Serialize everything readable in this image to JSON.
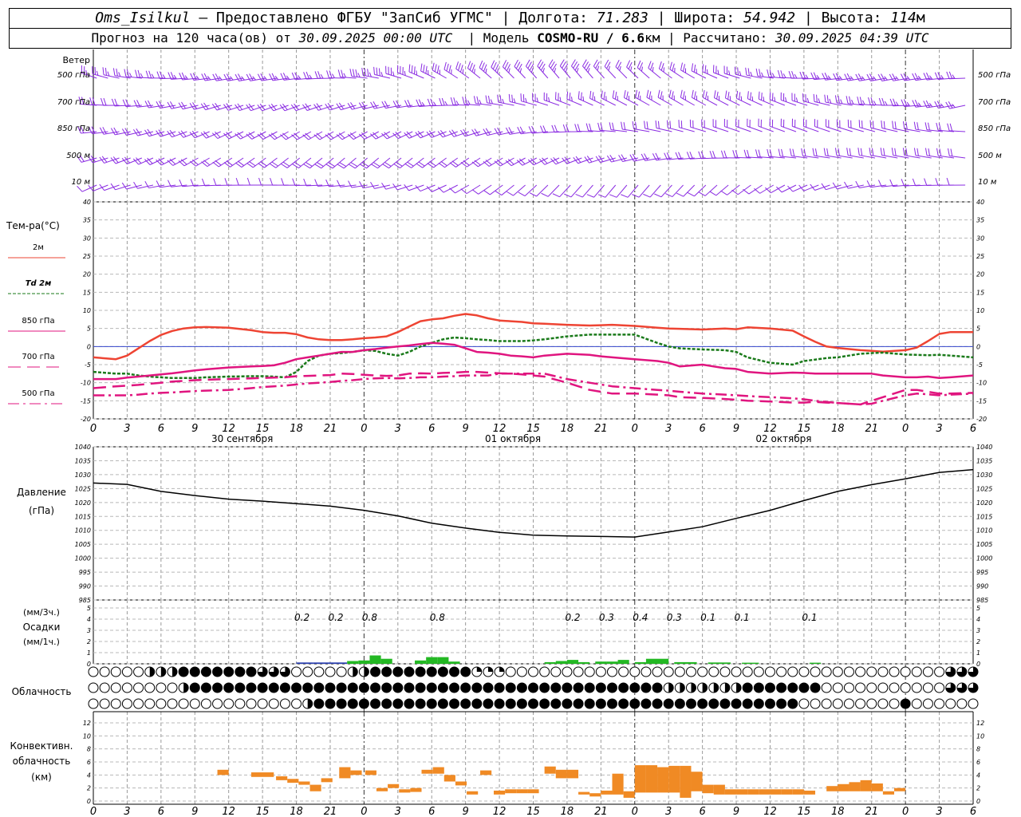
{
  "header": {
    "station": "Oms_Isilkul",
    "provider": "– Предоставлено ФГБУ \"ЗапСиб УГМС\"",
    "lon_label": "Долгота:",
    "lon": "71.283",
    "lat_label": "Широта:",
    "lat": "54.942",
    "alt_label": "Высота:",
    "alt": "114",
    "alt_unit": "м",
    "forecast_prefix": "Прогноз на 120 часа(ов) от",
    "forecast_start": "30.09.2025 00:00 UTC",
    "model_label": "Модель",
    "model": "COSMO-RU / 6.6",
    "model_unit": "км",
    "calc_label": "Рассчитано:",
    "calc_time": "30.09.2025 04:39 UTC"
  },
  "x_ticks": [
    "0",
    "3",
    "6",
    "9",
    "12",
    "15",
    "18",
    "21",
    "0",
    "3",
    "6",
    "9",
    "12",
    "15",
    "18",
    "21",
    "0",
    "3",
    "6",
    "9",
    "12",
    "15",
    "18",
    "21",
    "0",
    "3",
    "6"
  ],
  "date_labels": [
    "30 сентября",
    "01 октября",
    "02 октября"
  ],
  "wind_panel": {
    "title": "Ветер",
    "levels": [
      "500 гПа",
      "700 гПа",
      "850 гПа",
      "500 м",
      "10  м"
    ],
    "color": "#8a2be2"
  },
  "temp_panel": {
    "title": "Тем-ра(°C)",
    "legend": [
      {
        "label": "2м",
        "color": "#ee4433",
        "dash": "solid"
      },
      {
        "label": "Td  2м",
        "color": "#1a7a1a",
        "dash": "dotted"
      },
      {
        "label": "850 гПа",
        "color": "#e0157f",
        "dash": "solid"
      },
      {
        "label": "700 гПа",
        "color": "#e0157f",
        "dash": "dashed"
      },
      {
        "label": "500 гПа",
        "color": "#e0157f",
        "dash": "dashdot"
      }
    ],
    "y_ticks": [
      "40",
      "35",
      "30",
      "25",
      "20",
      "15",
      "10",
      "5",
      "0",
      "-5",
      "-10",
      "-15",
      "-20"
    ]
  },
  "pressure_panel": {
    "title": "Давление",
    "unit": "(гПа)",
    "y_ticks": [
      "1040",
      "1035",
      "1030",
      "1025",
      "1020",
      "1015",
      "1010",
      "1005",
      "1000",
      "995",
      "990",
      "985"
    ]
  },
  "precip_panel": {
    "unit_top": "(мм/3ч.)",
    "title": "Осадки",
    "unit_bottom": "(мм/1ч.)",
    "y_ticks": [
      "5",
      "4",
      "3",
      "2",
      "1",
      "0"
    ],
    "labels": [
      {
        "h": 18,
        "text": "0.2"
      },
      {
        "h": 21,
        "text": "0.2"
      },
      {
        "h": 24,
        "text": "0.8"
      },
      {
        "h": 30,
        "text": "0.8"
      },
      {
        "h": 42,
        "text": "0.2"
      },
      {
        "h": 45,
        "text": "0.3"
      },
      {
        "h": 48,
        "text": "0.4"
      },
      {
        "h": 51,
        "text": "0.3"
      },
      {
        "h": 54,
        "text": "0.1"
      },
      {
        "h": 57,
        "text": "0.1"
      },
      {
        "h": 63,
        "text": "0.1"
      }
    ]
  },
  "cloud_panel": {
    "title": "Облачность"
  },
  "conv_panel": {
    "title_line1": "Конвективн.",
    "title_line2": "облачность",
    "unit": "(км)",
    "y_ticks": [
      "12",
      "10",
      "8",
      "6",
      "4",
      "2",
      "0"
    ],
    "color": "#f08a24"
  },
  "chart_data": [
    {
      "type": "line",
      "title": "Тем-ра(°C)",
      "ylim": [
        -20,
        40
      ],
      "x_hours": [
        0,
        2,
        3,
        4,
        5,
        6,
        7,
        8,
        9,
        10,
        12,
        14,
        15,
        16,
        17,
        18,
        19,
        20,
        21,
        22,
        23,
        24,
        25,
        26,
        27,
        28,
        29,
        30,
        31,
        32,
        33,
        34,
        35,
        36,
        37,
        38,
        39,
        40,
        42,
        44,
        45,
        46,
        48,
        50,
        51,
        52,
        54,
        56,
        57,
        58,
        60,
        62,
        63,
        64,
        65,
        66,
        68,
        69,
        70,
        72,
        73,
        74,
        75,
        76,
        78
      ],
      "series": [
        {
          "name": "2м",
          "values": [
            -3,
            -3.5,
            -2.5,
            -0.5,
            1.5,
            3.2,
            4.3,
            5,
            5.3,
            5.4,
            5.2,
            4.5,
            4,
            3.8,
            3.8,
            3.4,
            2.5,
            2,
            1.8,
            1.8,
            2,
            2.3,
            2.5,
            2.8,
            4,
            5.5,
            7,
            7.5,
            7.8,
            8.5,
            9,
            8.6,
            7.8,
            7.2,
            7,
            6.8,
            6.4,
            6.3,
            6,
            5.8,
            5.9,
            6,
            5.7,
            5.2,
            5,
            4.9,
            4.7,
            5,
            4.8,
            5.3,
            5,
            4.4,
            2.8,
            1.3,
            0,
            -0.4,
            -1,
            -1.2,
            -1.4,
            -1,
            -0.3,
            1.5,
            3.5,
            4,
            4
          ]
        },
        {
          "name": "Td  2м",
          "values": [
            -7,
            -7.5,
            -7.5,
            -8,
            -8.3,
            -8.5,
            -8.7,
            -8.7,
            -8.7,
            -8.5,
            -8.3,
            -8.2,
            -8.2,
            -8.3,
            -8.5,
            -7,
            -4,
            -2.5,
            -2,
            -1.8,
            -1.5,
            -1,
            -1.2,
            -2,
            -2.5,
            -1.5,
            0,
            1,
            2,
            2.5,
            2.3,
            2,
            1.8,
            1.5,
            1.5,
            1.5,
            1.7,
            2,
            2.8,
            3.3,
            3.3,
            3.3,
            3.3,
            1,
            0,
            -0.5,
            -0.8,
            -1,
            -1.5,
            -3,
            -4.5,
            -5,
            -4,
            -3.6,
            -3.2,
            -3,
            -2,
            -1.8,
            -1.7,
            -2.2,
            -2.3,
            -2.4,
            -2.3,
            -2.5,
            -3
          ]
        },
        {
          "name": "850 гПа",
          "values": [
            -9,
            -9,
            -8.6,
            -8.3,
            -8,
            -7.7,
            -7.4,
            -7,
            -6.6,
            -6.3,
            -5.8,
            -5.5,
            -5.4,
            -5.2,
            -4.5,
            -3.5,
            -3,
            -2.5,
            -2,
            -1.5,
            -1.5,
            -1,
            -0.7,
            -0.3,
            0,
            0.3,
            0.7,
            1,
            0.8,
            0.5,
            -0.5,
            -1.5,
            -1.7,
            -2,
            -2.5,
            -2.7,
            -3,
            -2.5,
            -2,
            -2.3,
            -2.7,
            -3,
            -3.5,
            -4,
            -4.5,
            -5.5,
            -5,
            -6,
            -6.2,
            -7,
            -7.5,
            -7.2,
            -7.3,
            -7.5,
            -7.5,
            -7.5,
            -7.5,
            -7.5,
            -8,
            -8.5,
            -8.5,
            -8.3,
            -8.7,
            -8.5,
            -8
          ]
        },
        {
          "name": "700 гПа",
          "values": [
            -11.5,
            -11,
            -10.8,
            -10.6,
            -10.3,
            -10,
            -9.7,
            -9.5,
            -9.3,
            -9.2,
            -9,
            -8.8,
            -8.7,
            -8.6,
            -8.5,
            -8.2,
            -8.1,
            -8,
            -7.9,
            -7.5,
            -7.6,
            -7.8,
            -8,
            -8.1,
            -8,
            -7.5,
            -7.4,
            -7.5,
            -7.3,
            -7.2,
            -7,
            -7,
            -7.2,
            -7.4,
            -7.5,
            -7.7,
            -8,
            -8.3,
            -10,
            -12,
            -12.5,
            -13,
            -13,
            -13.3,
            -13.5,
            -14,
            -14.2,
            -14.5,
            -14.7,
            -15,
            -15.2,
            -15.5,
            -15.5,
            -15.3,
            -15.5,
            -15.6,
            -16,
            -15,
            -14,
            -12,
            -12,
            -12.5,
            -13,
            -13,
            -12.8
          ]
        },
        {
          "name": "500 гПа",
          "values": [
            -13.5,
            -13.5,
            -13.5,
            -13.3,
            -13,
            -12.8,
            -12.7,
            -12.5,
            -12.3,
            -12.2,
            -12,
            -11.5,
            -11.2,
            -11,
            -10.8,
            -10.5,
            -10.2,
            -10,
            -9.8,
            -9.5,
            -9.3,
            -9,
            -8.8,
            -8.7,
            -8.8,
            -8.7,
            -8.5,
            -8.5,
            -8.3,
            -8.2,
            -8,
            -8,
            -8,
            -7.5,
            -7.5,
            -7.5,
            -7.5,
            -7.5,
            -9,
            -10,
            -10.5,
            -11,
            -11.5,
            -12,
            -12.2,
            -12.5,
            -13,
            -13.3,
            -13.5,
            -13.7,
            -14,
            -14.3,
            -14.6,
            -15,
            -15.3,
            -15.6,
            -16,
            -15.8,
            -15,
            -13.5,
            -13,
            -13.2,
            -13.5,
            -13.3,
            -13
          ]
        }
      ]
    },
    {
      "type": "line",
      "title": "Давление",
      "ylabel": "(гПа)",
      "ylim": [
        985,
        1040
      ],
      "x_hours": [
        0,
        3,
        6,
        9,
        12,
        15,
        18,
        21,
        24,
        27,
        30,
        33,
        36,
        39,
        42,
        45,
        48,
        51,
        54,
        57,
        60,
        63,
        66,
        69,
        72,
        75,
        78
      ],
      "series": [
        {
          "name": "Давление",
          "values": [
            1027,
            1026.5,
            1024,
            1022.5,
            1021.2,
            1020.5,
            1019.6,
            1018.7,
            1017.2,
            1015.2,
            1012.6,
            1010.8,
            1009.3,
            1008.3,
            1008,
            1007.8,
            1007.6,
            1009.4,
            1011.3,
            1014.3,
            1017.2,
            1020.7,
            1024,
            1026.4,
            1028.5,
            1030.8,
            1031.8
          ]
        }
      ]
    },
    {
      "type": "bar",
      "title": "Осадки",
      "ylabel": "(мм/1ч.)",
      "ylim": [
        0,
        5
      ],
      "bars": [
        {
          "h": 18.5,
          "w": 1.5,
          "v": 0.12,
          "c": "#2b3fb0"
        },
        {
          "h": 20,
          "w": 1.5,
          "v": 0.12,
          "c": "#2b3fb0"
        },
        {
          "h": 21.5,
          "w": 1.5,
          "v": 0.12,
          "c": "#2b3fb0"
        },
        {
          "h": 23,
          "w": 1,
          "v": 0.25,
          "c": "#23b823"
        },
        {
          "h": 24,
          "w": 1,
          "v": 0.3,
          "c": "#23b823"
        },
        {
          "h": 25,
          "w": 1,
          "v": 0.75,
          "c": "#23b823"
        },
        {
          "h": 26,
          "w": 1,
          "v": 0.45,
          "c": "#23b823"
        },
        {
          "h": 29,
          "w": 1,
          "v": 0.3,
          "c": "#23b823"
        },
        {
          "h": 30,
          "w": 1,
          "v": 0.6,
          "c": "#23b823"
        },
        {
          "h": 31,
          "w": 1,
          "v": 0.6,
          "c": "#23b823"
        },
        {
          "h": 32,
          "w": 1,
          "v": 0.2,
          "c": "#23b823"
        },
        {
          "h": 40.5,
          "w": 1,
          "v": 0.15,
          "c": "#23b823"
        },
        {
          "h": 41.5,
          "w": 1,
          "v": 0.25,
          "c": "#23b823"
        },
        {
          "h": 42.5,
          "w": 1,
          "v": 0.35,
          "c": "#23b823"
        },
        {
          "h": 43.5,
          "w": 1,
          "v": 0.15,
          "c": "#23b823"
        },
        {
          "h": 45,
          "w": 1,
          "v": 0.2,
          "c": "#23b823"
        },
        {
          "h": 46,
          "w": 1,
          "v": 0.2,
          "c": "#23b823"
        },
        {
          "h": 47,
          "w": 1,
          "v": 0.35,
          "c": "#23b823"
        },
        {
          "h": 48.5,
          "w": 1,
          "v": 0.15,
          "c": "#23b823"
        },
        {
          "h": 49.5,
          "w": 2,
          "v": 0.45,
          "c": "#23b823"
        },
        {
          "h": 52,
          "w": 2,
          "v": 0.15,
          "c": "#23b823"
        },
        {
          "h": 55,
          "w": 2,
          "v": 0.12,
          "c": "#23b823"
        },
        {
          "h": 58,
          "w": 1.5,
          "v": 0.1,
          "c": "#23b823"
        },
        {
          "h": 64,
          "w": 1,
          "v": 0.1,
          "c": "#23b823"
        }
      ]
    },
    {
      "type": "bar",
      "title": "Конвективн. облачность",
      "ylabel": "(км)",
      "ylim": [
        0,
        13
      ],
      "bars": [
        {
          "h": 11.5,
          "w": 1,
          "b": 4.0,
          "t": 4.8
        },
        {
          "h": 14.5,
          "w": 2,
          "b": 3.7,
          "t": 4.4
        },
        {
          "h": 16.7,
          "w": 1,
          "b": 3.2,
          "t": 3.8
        },
        {
          "h": 17.7,
          "w": 1,
          "b": 2.8,
          "t": 3.4
        },
        {
          "h": 18.7,
          "w": 1,
          "b": 2.5,
          "t": 3.0
        },
        {
          "h": 19.7,
          "w": 1,
          "b": 1.5,
          "t": 2.5
        },
        {
          "h": 20.7,
          "w": 1,
          "b": 2.9,
          "t": 3.5
        },
        {
          "h": 22.3,
          "w": 1,
          "b": 3.5,
          "t": 5.2
        },
        {
          "h": 23.3,
          "w": 1,
          "b": 4.0,
          "t": 4.7
        },
        {
          "h": 24.6,
          "w": 1,
          "b": 4.0,
          "t": 4.7
        },
        {
          "h": 25.6,
          "w": 1,
          "b": 1.5,
          "t": 2.0
        },
        {
          "h": 26.6,
          "w": 1,
          "b": 2.0,
          "t": 2.6
        },
        {
          "h": 27.6,
          "w": 1,
          "b": 1.3,
          "t": 1.8
        },
        {
          "h": 28.6,
          "w": 1,
          "b": 1.4,
          "t": 2.0
        },
        {
          "h": 29.6,
          "w": 1,
          "b": 4.2,
          "t": 4.8
        },
        {
          "h": 30.6,
          "w": 1,
          "b": 4.2,
          "t": 5.2
        },
        {
          "h": 31.6,
          "w": 1,
          "b": 3.0,
          "t": 4.0
        },
        {
          "h": 32.6,
          "w": 1,
          "b": 2.4,
          "t": 3.0
        },
        {
          "h": 33.6,
          "w": 1,
          "b": 1.0,
          "t": 1.5
        },
        {
          "h": 34.8,
          "w": 1,
          "b": 4.0,
          "t": 4.7
        },
        {
          "h": 36.0,
          "w": 1,
          "b": 1.0,
          "t": 1.6
        },
        {
          "h": 37.0,
          "w": 1,
          "b": 1.2,
          "t": 1.8
        },
        {
          "h": 38.0,
          "w": 1,
          "b": 1.2,
          "t": 1.8
        },
        {
          "h": 39.0,
          "w": 1,
          "b": 1.2,
          "t": 1.8
        },
        {
          "h": 40.5,
          "w": 1,
          "b": 4.2,
          "t": 5.3
        },
        {
          "h": 41.5,
          "w": 1,
          "b": 3.5,
          "t": 4.8
        },
        {
          "h": 42.5,
          "w": 1,
          "b": 3.5,
          "t": 4.8
        },
        {
          "h": 43.5,
          "w": 1,
          "b": 1.0,
          "t": 1.4
        },
        {
          "h": 44.5,
          "w": 1,
          "b": 0.7,
          "t": 1.2
        },
        {
          "h": 45.5,
          "w": 1,
          "b": 1.0,
          "t": 1.6
        },
        {
          "h": 46.5,
          "w": 1,
          "b": 1.0,
          "t": 4.2
        },
        {
          "h": 47.5,
          "w": 1,
          "b": 0.5,
          "t": 1.5
        },
        {
          "h": 48.5,
          "w": 1,
          "b": 1.3,
          "t": 5.5
        },
        {
          "h": 49.5,
          "w": 1,
          "b": 1.3,
          "t": 5.5
        },
        {
          "h": 50.5,
          "w": 1,
          "b": 1.3,
          "t": 5.2
        },
        {
          "h": 51.5,
          "w": 1,
          "b": 1.3,
          "t": 5.4
        },
        {
          "h": 52.5,
          "w": 1,
          "b": 0.5,
          "t": 5.4
        },
        {
          "h": 53.5,
          "w": 1,
          "b": 1.5,
          "t": 4.5
        },
        {
          "h": 54.5,
          "w": 1,
          "b": 1.2,
          "t": 2.5
        },
        {
          "h": 55.5,
          "w": 1,
          "b": 1.0,
          "t": 2.5
        },
        {
          "h": 56.5,
          "w": 1,
          "b": 1.0,
          "t": 1.8
        },
        {
          "h": 57.5,
          "w": 1,
          "b": 1.0,
          "t": 1.8
        },
        {
          "h": 58.5,
          "w": 1,
          "b": 1.0,
          "t": 1.8
        },
        {
          "h": 59.5,
          "w": 1,
          "b": 1.0,
          "t": 1.8
        },
        {
          "h": 60.5,
          "w": 1,
          "b": 1.0,
          "t": 1.8
        },
        {
          "h": 61.5,
          "w": 1,
          "b": 1.0,
          "t": 1.8
        },
        {
          "h": 62.5,
          "w": 1,
          "b": 1.0,
          "t": 1.8
        },
        {
          "h": 63.5,
          "w": 1,
          "b": 1.0,
          "t": 1.6
        },
        {
          "h": 65.5,
          "w": 1,
          "b": 1.5,
          "t": 2.3
        },
        {
          "h": 66.5,
          "w": 1,
          "b": 1.5,
          "t": 2.6
        },
        {
          "h": 67.5,
          "w": 1,
          "b": 1.5,
          "t": 2.9
        },
        {
          "h": 68.5,
          "w": 1,
          "b": 1.5,
          "t": 3.2
        },
        {
          "h": 69.5,
          "w": 1,
          "b": 1.5,
          "t": 2.7
        },
        {
          "h": 70.5,
          "w": 1,
          "b": 1.0,
          "t": 1.5
        },
        {
          "h": 71.5,
          "w": 1,
          "b": 1.5,
          "t": 2.0
        }
      ]
    }
  ]
}
